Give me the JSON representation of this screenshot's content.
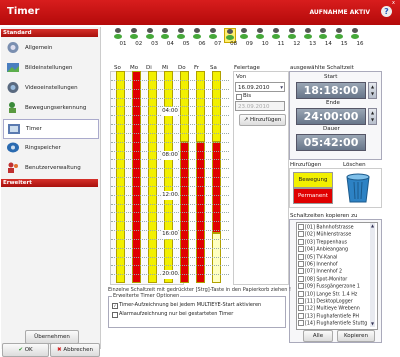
{
  "app": {
    "title": "Timer",
    "status": "AUFNAHME AKTIV",
    "help_label": "?",
    "close_label": "x"
  },
  "sidebar": {
    "standard_label": "Standard",
    "erweitert_label": "Erweitert",
    "items": [
      {
        "label": "Allgemein"
      },
      {
        "label": "Bildeinstellungen"
      },
      {
        "label": "Videoeinstellungen"
      },
      {
        "label": "Bewegungserkennung"
      },
      {
        "label": "Timer"
      },
      {
        "label": "Ringspeicher"
      },
      {
        "label": "Benutzerverwaltung"
      }
    ],
    "apply_label": "Übernehmen",
    "ok_label": "OK",
    "cancel_label": "Abbrechen"
  },
  "rows": [
    "01",
    "02",
    "03",
    "04",
    "05",
    "06",
    "07",
    "08",
    "09",
    "10",
    "11",
    "12",
    "13",
    "14",
    "15",
    "16"
  ],
  "selected_row": "08",
  "days": [
    "So",
    "Mo",
    "Di",
    "Mi",
    "Do",
    "Fr",
    "Sa"
  ],
  "hours": [
    "04:00",
    "08:00",
    "12:00",
    "16:00",
    "20:00"
  ],
  "feiertage": {
    "label": "Feiertage",
    "von_label": "Von",
    "von_value": "16.09.2010",
    "bis_label": "Bis",
    "bis_value": "23.09.2010",
    "add_label": "Hinzufügen"
  },
  "zeit": {
    "title": "ausgewählte Schaltzeit",
    "start_label": "Start",
    "start_value": "18:18:00",
    "ende_label": "Ende",
    "ende_value": "24:00:00",
    "dauer_label": "Dauer",
    "dauer_value": "05:42:00"
  },
  "add_delete": {
    "add_label": "Hinzufügen",
    "delete_label": "Löschen",
    "bewegung_label": "Bewegung",
    "permanent_label": "Permanent"
  },
  "copy": {
    "title": "Schaltzeiten kopieren zu",
    "items": [
      "[01] Bahnhofstrasse",
      "[02] Mühlenstrasse",
      "[03] Treppenhaus",
      "[04] Anbieangang",
      "[05] TV-Kanal",
      "[06] Innenhof",
      "[07] Innenhof 2",
      "[08] Spot-Monitor",
      "[09] Fussgängerzone 1",
      "[10] Lange Str. 1.4 Hz",
      "[11] DesktopLogger",
      "[12] Multieye Wrebenn",
      "[13] Flughafentiefe PH",
      "[14] Flughafentiefe Stuttg"
    ],
    "all_label": "Alle",
    "copy_label": "Kopieren"
  },
  "hint": "Einzelne Schaltzeit mit gedrückter [Strg]-Taste in den Papierkorb ziehen !",
  "options": {
    "title": "Erweiterte Timer Optionen",
    "opt1": "Timer-Aufzeichnung bei jedem MULTIEYE-Start aktivieren",
    "opt2": "Alarmaufzeichnung nur bei gestarteten Timer"
  },
  "colors": {
    "red": "#e00000",
    "yellow": "#f2f000",
    "pale": "#ffffc0",
    "accent": "#c80f0f"
  }
}
